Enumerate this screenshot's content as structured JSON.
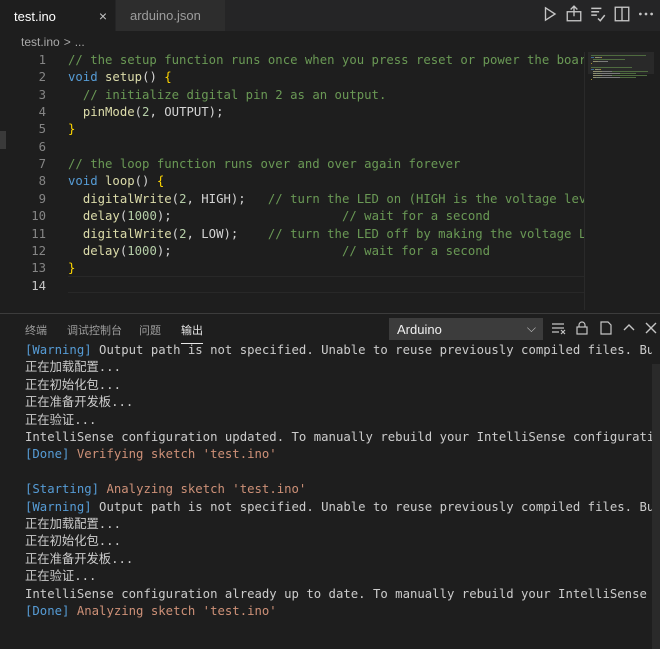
{
  "tabs": [
    {
      "label": "test.ino",
      "close": "×"
    },
    {
      "label": "arduino.json"
    }
  ],
  "toolbar_icons": [
    "run-icon",
    "upload-icon",
    "verify-icon",
    "split-editor-icon",
    "more-icon"
  ],
  "breadcrumb": {
    "file": "test.ino",
    "sep": ">",
    "rest": "..."
  },
  "editor": {
    "line_numbers": [
      "1",
      "2",
      "3",
      "4",
      "5",
      "6",
      "7",
      "8",
      "9",
      "10",
      "11",
      "12",
      "13",
      "14"
    ],
    "lines": [
      [
        {
          "t": "// the setup function runs once when you press reset or power the board",
          "c": "cm"
        }
      ],
      [
        {
          "t": "void",
          "c": "kw"
        },
        {
          "t": " "
        },
        {
          "t": "setup",
          "c": "fn"
        },
        {
          "t": "() "
        },
        {
          "t": "{",
          "c": "br1"
        }
      ],
      [
        {
          "t": "  "
        },
        {
          "t": "// initialize digital pin 2 as an output.",
          "c": "cm"
        }
      ],
      [
        {
          "t": "  "
        },
        {
          "t": "pinMode",
          "c": "fn"
        },
        {
          "t": "("
        },
        {
          "t": "2",
          "c": "num"
        },
        {
          "t": ", OUTPUT);"
        }
      ],
      [
        {
          "t": "}",
          "c": "br1"
        }
      ],
      [],
      [
        {
          "t": "// the loop function runs over and over again forever",
          "c": "cm"
        }
      ],
      [
        {
          "t": "void",
          "c": "kw"
        },
        {
          "t": " "
        },
        {
          "t": "loop",
          "c": "fn"
        },
        {
          "t": "() "
        },
        {
          "t": "{",
          "c": "br1"
        }
      ],
      [
        {
          "t": "  "
        },
        {
          "t": "digitalWrite",
          "c": "fn"
        },
        {
          "t": "("
        },
        {
          "t": "2",
          "c": "num"
        },
        {
          "t": ", HIGH);   "
        },
        {
          "t": "// turn the LED on (HIGH is the voltage level)",
          "c": "cm"
        }
      ],
      [
        {
          "t": "  "
        },
        {
          "t": "delay",
          "c": "fn"
        },
        {
          "t": "("
        },
        {
          "t": "1000",
          "c": "num"
        },
        {
          "t": ");                       "
        },
        {
          "t": "// wait for a second",
          "c": "cm"
        }
      ],
      [
        {
          "t": "  "
        },
        {
          "t": "digitalWrite",
          "c": "fn"
        },
        {
          "t": "("
        },
        {
          "t": "2",
          "c": "num"
        },
        {
          "t": ", LOW);    "
        },
        {
          "t": "// turn the LED off by making the voltage LOW",
          "c": "cm"
        }
      ],
      [
        {
          "t": "  "
        },
        {
          "t": "delay",
          "c": "fn"
        },
        {
          "t": "("
        },
        {
          "t": "1000",
          "c": "num"
        },
        {
          "t": ");                       "
        },
        {
          "t": "// wait for a second",
          "c": "cm"
        }
      ],
      [
        {
          "t": "}",
          "c": "br1"
        }
      ],
      []
    ],
    "current_line": "14"
  },
  "panel": {
    "tabs": [
      {
        "label": "终端",
        "active": false
      },
      {
        "label": "调试控制台",
        "active": false
      },
      {
        "label": "问题",
        "active": false
      },
      {
        "label": "输出",
        "active": true
      }
    ],
    "channel": "Arduino",
    "output_lines": [
      [
        {
          "t": "[Warning]",
          "c": "blue"
        },
        {
          "t": " Output path is not specified. Unable to reuse previously compiled files. Build will be slower."
        }
      ],
      [
        {
          "t": "正在加载配置..."
        }
      ],
      [
        {
          "t": "正在初始化包..."
        }
      ],
      [
        {
          "t": "正在准备开发板..."
        }
      ],
      [
        {
          "t": "正在验证..."
        }
      ],
      [
        {
          "t": "IntelliSense configuration updated. To manually rebuild your IntelliSense configuration run"
        }
      ],
      [
        {
          "t": "[Done]",
          "c": "blue"
        },
        {
          "t": " Verifying sketch 'test.ino'",
          "c": "orange"
        }
      ],
      [],
      [
        {
          "t": "[Starting]",
          "c": "blue"
        },
        {
          "t": " Analyzing sketch 'test.ino'",
          "c": "orange"
        }
      ],
      [
        {
          "t": "[Warning]",
          "c": "blue"
        },
        {
          "t": " Output path is not specified. Unable to reuse previously compiled files. Build will be slower."
        }
      ],
      [
        {
          "t": "正在加载配置..."
        }
      ],
      [
        {
          "t": "正在初始化包..."
        }
      ],
      [
        {
          "t": "正在准备开发板..."
        }
      ],
      [
        {
          "t": "正在验证..."
        }
      ],
      [
        {
          "t": "IntelliSense configuration already up to date. To manually rebuild your IntelliSense configuration run"
        }
      ],
      [
        {
          "t": "[Done]",
          "c": "blue"
        },
        {
          "t": " Analyzing sketch 'test.ino'",
          "c": "orange"
        }
      ]
    ]
  }
}
